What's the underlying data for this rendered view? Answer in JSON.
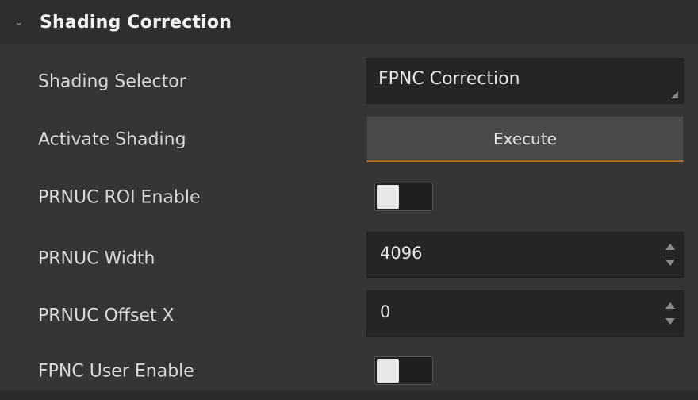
{
  "section": {
    "title": "Shading Correction",
    "icon": "chevron-down-icon"
  },
  "rows": {
    "shading_selector": {
      "label": "Shading Selector",
      "value": "FPNC Correction"
    },
    "activate_shading": {
      "label": "Activate Shading",
      "button_label": "Execute"
    },
    "prnuc_roi_enable": {
      "label": "PRNUC ROI Enable",
      "state": "off"
    },
    "prnuc_width": {
      "label": "PRNUC Width",
      "value": "4096"
    },
    "prnuc_offset_x": {
      "label": "PRNUC Offset X",
      "value": "0"
    },
    "fpnc_user_enable": {
      "label": "FPNC User Enable",
      "state": "off"
    }
  },
  "colors": {
    "panel_bg": "#353535",
    "header_bg": "#2e2e2e",
    "field_bg": "#252525",
    "button_bg": "#4a4a4a",
    "accent": "#b36a25"
  }
}
